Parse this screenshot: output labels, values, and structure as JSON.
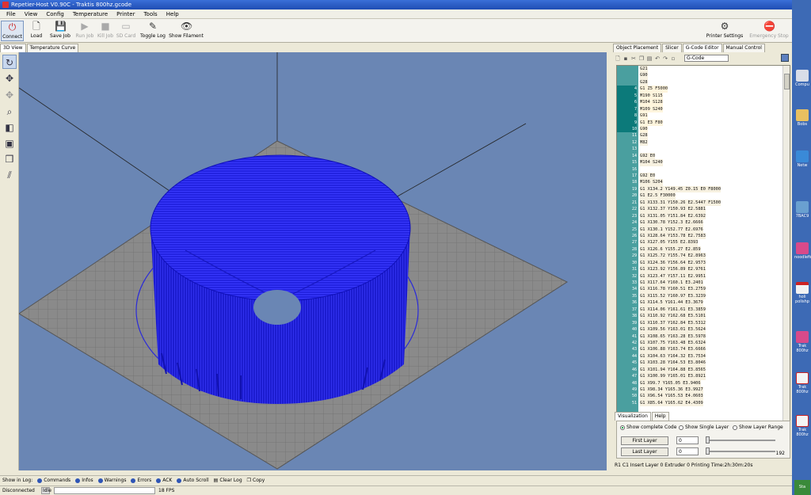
{
  "window": {
    "title": "Repetier-Host V0.90C - Traktis 800hz.gcode"
  },
  "menu": [
    "File",
    "View",
    "Config",
    "Temperature",
    "Printer",
    "Tools",
    "Help"
  ],
  "toolbar": {
    "connect": "Connect",
    "load": "Load",
    "save_job": "Save Job",
    "run_job": "Run Job",
    "kill_job": "Kill Job",
    "sd_card": "SD Card",
    "toggle_log": "Toggle Log",
    "show_filament": "Show Filament",
    "printer_settings": "Printer Settings",
    "emergency_stop": "Emergency Stop"
  },
  "left_tabs": [
    "3D View",
    "Temperature Curve"
  ],
  "right_tabs": [
    "Object Placement",
    "Slicer",
    "G-Code Editor",
    "Manual Control"
  ],
  "gcode_select": "G-Code",
  "gcode_lines": [
    {
      "n": "",
      "code": "G21"
    },
    {
      "n": "",
      "code": "G90"
    },
    {
      "n": "",
      "code": "G28"
    },
    {
      "n": "4",
      "code": "G1 Z5 F5000"
    },
    {
      "n": "5",
      "code": "M190 S115"
    },
    {
      "n": "6",
      "code": "M104 S128"
    },
    {
      "n": "7",
      "code": "M109 S240"
    },
    {
      "n": "8",
      "code": "G91"
    },
    {
      "n": "9",
      "code": "G1 E3 F80"
    },
    {
      "n": "10",
      "code": "G90"
    },
    {
      "n": "11",
      "code": "G28"
    },
    {
      "n": "12",
      "code": "M82"
    },
    {
      "n": "13",
      "code": ""
    },
    {
      "n": "14",
      "code": "G92 E0"
    },
    {
      "n": "15",
      "code": "M104 S240"
    },
    {
      "n": "16",
      "code": ""
    },
    {
      "n": "17",
      "code": "G92 E0"
    },
    {
      "n": "18",
      "code": "M106 S204"
    },
    {
      "n": "19",
      "code": "G1 X134.2 Y149.45 Z0.15 E0 F8000"
    },
    {
      "n": "20",
      "code": "G1 E2.5 F30000"
    },
    {
      "n": "21",
      "code": "G1 X133.31 Y150.26 E2.5447 F1500"
    },
    {
      "n": "22",
      "code": "G1 X132.37 Y150.93 E2.5881"
    },
    {
      "n": "23",
      "code": "G1 X131.05 Y151.84 E2.6392"
    },
    {
      "n": "24",
      "code": "G1 X130.78 Y152.3 E2.6666"
    },
    {
      "n": "25",
      "code": "G1 X130.1 Y152.77 E2.6976"
    },
    {
      "n": "26",
      "code": "G1 X128.64 Y153.78 E2.7583"
    },
    {
      "n": "27",
      "code": "G1 X127.05 Y155 E2.8393"
    },
    {
      "n": "28",
      "code": "G1 X126.6 Y155.27 E2.859"
    },
    {
      "n": "29",
      "code": "G1 X125.72 Y155.74 E2.8963"
    },
    {
      "n": "30",
      "code": "G1 X124.36 Y156.64 E2.9573"
    },
    {
      "n": "31",
      "code": "G1 X123.92 Y156.89 E2.9761"
    },
    {
      "n": "32",
      "code": "G1 X123.47 Y157.11 E2.9951"
    },
    {
      "n": "33",
      "code": "G1 X117.64 Y160.1 E3.2401"
    },
    {
      "n": "34",
      "code": "G1 X116.78 Y160.51 E3.2759"
    },
    {
      "n": "35",
      "code": "G1 X115.52 Y160.97 E3.3239"
    },
    {
      "n": "36",
      "code": "G1 X114.5 Y161.44 E3.3679"
    },
    {
      "n": "37",
      "code": "G1 X114.06 Y161.61 E3.3859"
    },
    {
      "n": "38",
      "code": "G1 X110.92 Y162.68 E3.5101"
    },
    {
      "n": "39",
      "code": "G1 X110.37 Y162.84 E3.5312"
    },
    {
      "n": "40",
      "code": "G1 X109.56 Y163.01 E3.5624"
    },
    {
      "n": "41",
      "code": "G1 X108.65 Y163.28 E3.5978"
    },
    {
      "n": "42",
      "code": "G1 X107.75 Y163.48 E3.6324"
    },
    {
      "n": "43",
      "code": "G1 X106.88 Y163.74 E3.6666"
    },
    {
      "n": "44",
      "code": "G1 X104.63 Y164.32 E3.7534"
    },
    {
      "n": "45",
      "code": "G1 X103.28 Y164.53 E3.8046"
    },
    {
      "n": "46",
      "code": "G1 X101.94 Y164.88 E3.8565"
    },
    {
      "n": "47",
      "code": "G1 X100.99 Y165.01 E3.8921"
    },
    {
      "n": "48",
      "code": "G1 X99.7 Y165.05 E3.9406"
    },
    {
      "n": "49",
      "code": "G1 X98.34 Y165.36 E3.9927"
    },
    {
      "n": "50",
      "code": "G1 X96.54 Y165.53 E4.0603"
    },
    {
      "n": "51",
      "code": "G1 X85.64 Y165.62 E4.4309"
    }
  ],
  "vis_tabs": [
    "Visualization",
    "Help"
  ],
  "vis": {
    "opt1": "Show complete Code",
    "opt2": "Show Single Layer",
    "opt3": "Show Layer Range",
    "first_layer": "First Layer",
    "last_layer": "Last Layer",
    "first_val": "0",
    "last_val": "0",
    "max": "192"
  },
  "right_status": "R1  C1  Insert  Layer 0  Extruder 0  Printing Time:2h:30m:20s",
  "log": {
    "show": "Show in Log:",
    "commands": "Commands",
    "infos": "Infos",
    "warnings": "Warnings",
    "errors": "Errors",
    "ack": "ACK",
    "auto_scroll": "Auto Scroll",
    "clear": "Clear Log",
    "copy": "Copy"
  },
  "status": {
    "conn": "Disconnected",
    "idle": "Idle",
    "fps": "18 FPS"
  },
  "desktop": [
    "Compu",
    "Bobs",
    "Netw",
    "7BAC9",
    "noodlefin",
    "holi polishp",
    "Trak 800hz",
    "Trak 800hz",
    "Trak 800hz",
    "Sta"
  ],
  "colors": {
    "model": "#2424e6",
    "bed": "#808080",
    "grid": "#6e6e6e"
  }
}
